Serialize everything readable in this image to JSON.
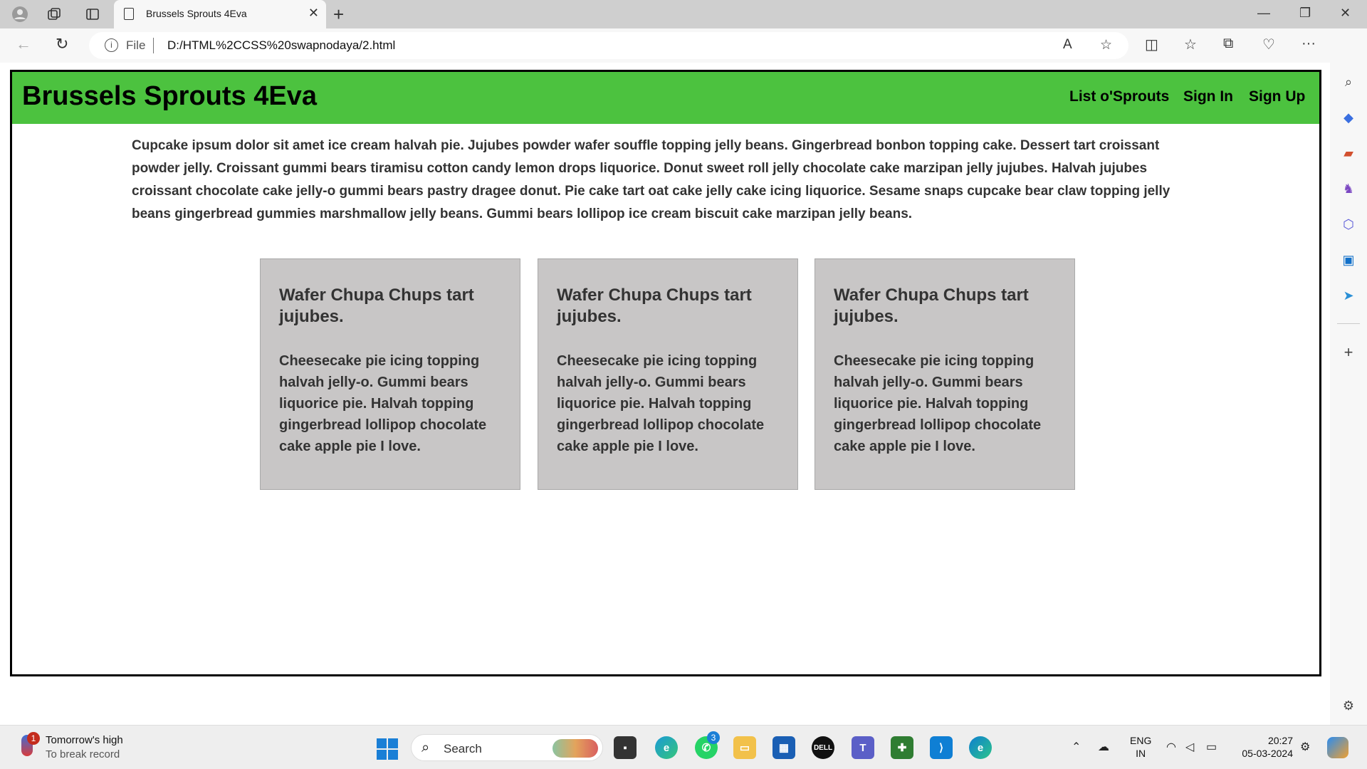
{
  "browser": {
    "tab_title": "Brussels Sprouts 4Eva",
    "address_prefix": "File",
    "url": "D:/HTML%2CCSS%20swapnodaya/2.html"
  },
  "site": {
    "brand": "Brussels Sprouts 4Eva",
    "nav": [
      "List o'Sprouts",
      "Sign In",
      "Sign Up"
    ],
    "intro": "Cupcake ipsum dolor sit amet ice cream halvah pie. Jujubes powder wafer souffle topping jelly beans. Gingerbread bonbon topping cake. Dessert tart croissant powder jelly. Croissant gummi bears tiramisu cotton candy lemon drops liquorice. Donut sweet roll jelly chocolate cake marzipan jelly jujubes. Halvah jujubes croissant chocolate cake jelly-o gummi bears pastry dragee donut. Pie cake tart oat cake jelly cake icing liquorice. Sesame snaps cupcake bear claw topping jelly beans gingerbread gummies marshmallow jelly beans. Gummi bears lollipop ice cream biscuit cake marzipan jelly beans.",
    "cards": [
      {
        "title": "Wafer Chupa Chups tart jujubes.",
        "body": "Cheesecake pie icing topping halvah jelly-o. Gummi bears liquorice pie. Halvah topping gingerbread lollipop chocolate cake apple pie I love."
      },
      {
        "title": "Wafer Chupa Chups tart jujubes.",
        "body": "Cheesecake pie icing topping halvah jelly-o. Gummi bears liquorice pie. Halvah topping gingerbread lollipop chocolate cake apple pie I love."
      },
      {
        "title": "Wafer Chupa Chups tart jujubes.",
        "body": "Cheesecake pie icing topping halvah jelly-o. Gummi bears liquorice pie. Halvah topping gingerbread lollipop chocolate cake apple pie I love."
      }
    ]
  },
  "taskbar": {
    "weather_line1": "Tomorrow's high",
    "weather_line2": "To break record",
    "weather_badge": "1",
    "search_label": "Search",
    "whatsapp_badge": "3",
    "lang_line1": "ENG",
    "lang_line2": "IN",
    "time": "20:27",
    "date": "05-03-2024"
  },
  "colors": {
    "header_green": "#4cc23f",
    "card_gray": "#c8c6c6"
  }
}
